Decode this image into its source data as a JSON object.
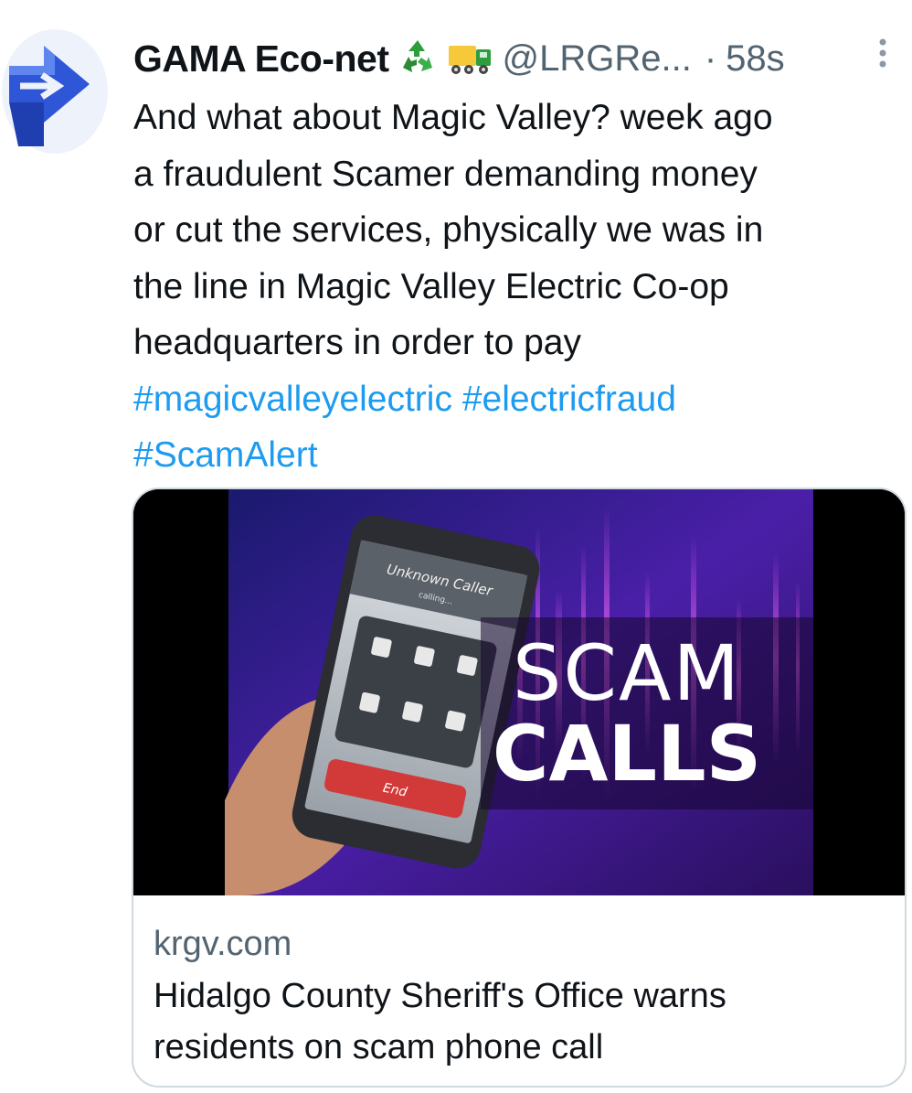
{
  "author": {
    "display_name": "GAMA Eco-net",
    "emoji_icons": [
      "recycle-icon",
      "truck-icon"
    ],
    "handle": "@LRGRe...",
    "separator": "·",
    "timestamp": "58s"
  },
  "tweet": {
    "lines": [
      "And what about Magic Valley?  week ago",
      "a fraudulent Scamer demanding money",
      "or cut the services, physically we was in",
      "the line in Magic Valley Electric Co-op",
      "headquarters in order to pay"
    ],
    "hashtags": [
      "#magicvalleyelectric",
      "#electricfraud",
      "#ScamAlert"
    ]
  },
  "card": {
    "image_text": {
      "caller": "Unknown Caller",
      "calling": "calling...",
      "end_button": "End",
      "headline_1": "SCAM",
      "headline_2": "CALLS"
    },
    "domain": "krgv.com",
    "title_line_1": "Hidalgo County Sheriff's Office warns",
    "title_line_2": "residents on scam phone call"
  },
  "colors": {
    "link": "#1d9bf0",
    "secondary_text": "#536471",
    "card_border": "#cfd9de",
    "avatar_blue": "#2f56d6"
  }
}
